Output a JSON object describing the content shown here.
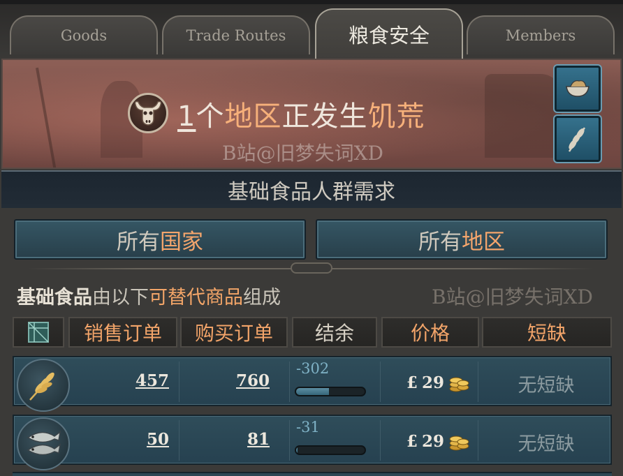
{
  "tabs": [
    {
      "label": "Goods",
      "active": false
    },
    {
      "label": "Trade Routes",
      "active": false
    },
    {
      "label": "粮食安全",
      "active": true
    },
    {
      "label": "Members",
      "active": false
    }
  ],
  "banner": {
    "famine_count": "1",
    "famine_unit": "个",
    "famine_region": "地区",
    "famine_verb": "正发生",
    "famine_word": "饥荒",
    "watermark": "B站@旧梦失词XD",
    "icon": "cow-skull-icon",
    "side_buttons": [
      "bowl-icon",
      "grain-leaf-icon"
    ]
  },
  "section_title": "基础食品人群需求",
  "scope": {
    "countries_prefix": "所有",
    "countries_hl": "国家",
    "regions_prefix": "所有",
    "regions_hl": "地区"
  },
  "description": {
    "bold": "基础食品",
    "mid": "由以下",
    "hl": "可替代商品",
    "end": "组成",
    "watermark": "B站@旧梦失词XD"
  },
  "table": {
    "columns": [
      "销售订单",
      "购买订单",
      "结余",
      "价格",
      "短缺"
    ],
    "filter_icon": "checkbox-grid-icon",
    "currency_symbol": "£",
    "rows": [
      {
        "icon": "wheat-icon",
        "sell": "457",
        "buy": "760",
        "balance": "-302",
        "balance_fill": 0.48,
        "price": "29",
        "shortage": "无短缺"
      },
      {
        "icon": "fish-icon",
        "sell": "50",
        "buy": "81",
        "balance": "-31",
        "balance_fill": 0.02,
        "price": "29",
        "shortage": "无短缺"
      }
    ]
  },
  "colors": {
    "accent_orange": "#f4a56c",
    "panel_teal": "#2f4d5a",
    "banner_red": "#8d5f56"
  }
}
